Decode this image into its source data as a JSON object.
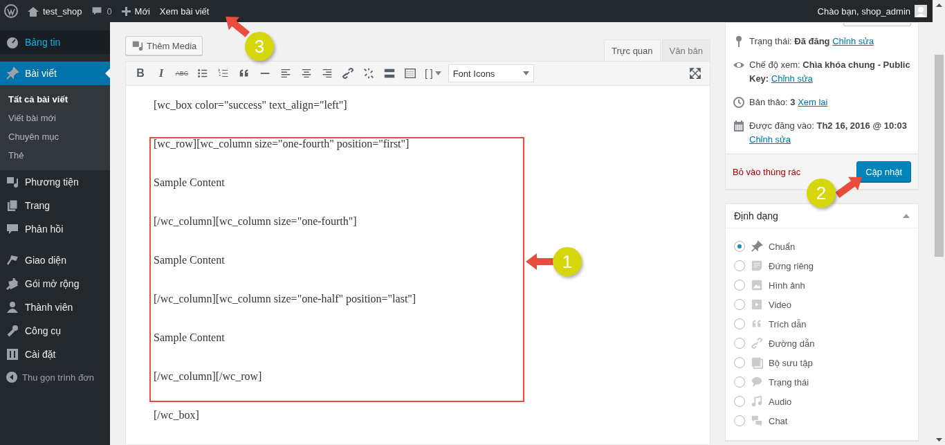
{
  "admin_bar": {
    "site": "test_shop",
    "comments": "0",
    "new": "Mới",
    "view_post": "Xem bài viết",
    "greeting": "Chào bạn, shop_admin"
  },
  "sidebar": {
    "groups": [
      [
        {
          "label": "Bảng tin",
          "selected": false,
          "hovered": true
        }
      ],
      [
        {
          "label": "Bài viết",
          "selected": true,
          "hovered": false,
          "children": [
            {
              "label": "Tất cả bài viết",
              "selected": true
            },
            {
              "label": "Viết bài mới",
              "selected": false
            },
            {
              "label": "Chuyên mục",
              "selected": false
            },
            {
              "label": "Thẻ",
              "selected": false
            }
          ]
        },
        {
          "label": "Phương tiện",
          "selected": false,
          "hovered": false
        },
        {
          "label": "Trang",
          "selected": false,
          "hovered": false
        },
        {
          "label": "Phản hồi",
          "selected": false,
          "hovered": false
        }
      ],
      [
        {
          "label": "Giao diện",
          "selected": false,
          "hovered": false
        },
        {
          "label": "Gói mở rộng",
          "selected": false,
          "hovered": false
        },
        {
          "label": "Thành viên",
          "selected": false,
          "hovered": false
        },
        {
          "label": "Công cụ",
          "selected": false,
          "hovered": false
        },
        {
          "label": "Cài đặt",
          "selected": false,
          "hovered": false
        }
      ]
    ],
    "collapse": "Thu gọn trình đơn"
  },
  "editor": {
    "add_media": "Thêm Media",
    "tabs": [
      {
        "label": "Trực quan",
        "selected": true
      },
      {
        "label": "Văn bản",
        "selected": false
      }
    ],
    "toolbar": {
      "glyphs": [
        "B",
        "I",
        "ABC"
      ],
      "shortcode": "[ ]",
      "font_select": "Font Icons"
    },
    "paragraphs": [
      "[wc_box color=\"success\" text_align=\"left\"]",
      "[wc_row][wc_column size=\"one-fourth\" position=\"first\"]",
      "Sample Content",
      "[/wc_column][wc_column size=\"one-fourth\"]",
      "Sample Content",
      "[/wc_column][wc_column size=\"one-half\" position=\"last\"]",
      "Sample Content",
      "[/wc_column][/wc_row]",
      "[/wc_box]"
    ]
  },
  "publish": {
    "rows": [
      {
        "text": "Trạng thái: **Đã đăng**",
        "link": "Chỉnh sửa"
      },
      {
        "text": "Chế độ xem: **Chìa khóa chung - Public Key:**",
        "link": "Chỉnh sửa"
      },
      {
        "text": "Bản thảo: **3**",
        "link": "Xem lai"
      },
      {
        "text": "Được đăng vào: **Th2 16, 2016 @ 10:03**",
        "link": "Chỉnh sửa"
      }
    ],
    "trash": "Bỏ vào thùng rác",
    "update": "Cập nhật"
  },
  "format": {
    "title": "Định dạng",
    "options": [
      {
        "label": "Chuẩn",
        "selected": true
      },
      {
        "label": "Đứng riêng",
        "selected": false
      },
      {
        "label": "Hình ảnh",
        "selected": false
      },
      {
        "label": "Video",
        "selected": false
      },
      {
        "label": "Trích dẫn",
        "selected": false
      },
      {
        "label": "Đường dẫn",
        "selected": false
      },
      {
        "label": "Bộ sưu tập",
        "selected": false
      },
      {
        "label": "Trạng thái",
        "selected": false
      },
      {
        "label": "Audio",
        "selected": false
      },
      {
        "label": "Chat",
        "selected": false
      }
    ]
  },
  "annotations": [
    {
      "label": "3"
    },
    {
      "label": "2"
    },
    {
      "label": "1"
    }
  ]
}
